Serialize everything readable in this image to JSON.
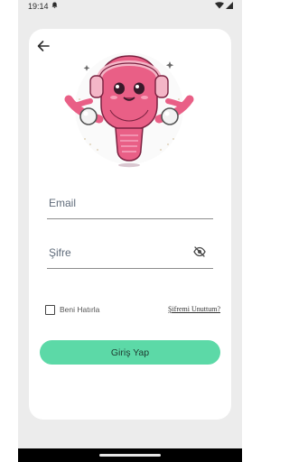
{
  "status_bar": {
    "time": "19:14",
    "notification_icon": "bell-icon",
    "wifi_icon": "wifi-icon",
    "signal_icon": "cell-signal-icon"
  },
  "header": {
    "back_icon": "arrow-left-icon"
  },
  "mascot": {
    "icon": "uterus-mascot-with-headphones"
  },
  "form": {
    "email_placeholder": "Email",
    "password_placeholder": "Şifre",
    "visibility_icon": "eye-off-icon",
    "remember_label": "Beni Hatırla",
    "remember_checked": false,
    "forgot_label": "Şifremi Unuttum?",
    "login_label": "Giriş Yap"
  },
  "colors": {
    "accent": "#5cd9a7",
    "background": "#ececec",
    "card": "#ffffff",
    "mascot_pink": "#e95f86"
  }
}
